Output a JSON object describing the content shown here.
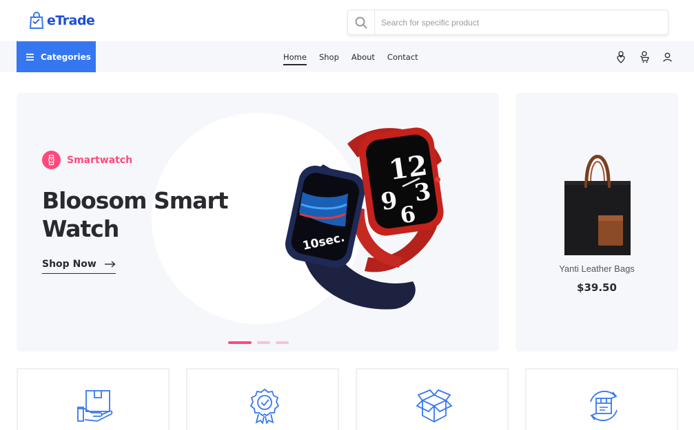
{
  "header": {
    "brand_name": "eTrade",
    "logo_icon": "shopping-bag-icon",
    "search": {
      "placeholder": "Search for specific product",
      "value": "",
      "icon": "search-icon"
    }
  },
  "nav": {
    "categories_label": "Categories",
    "categories_icon": "menu-icon",
    "links": [
      {
        "label": "Home",
        "active": true
      },
      {
        "label": "Shop",
        "active": false
      },
      {
        "label": "About",
        "active": false
      },
      {
        "label": "Contact",
        "active": false
      }
    ],
    "icons": [
      "wishlist-icon",
      "cart-icon",
      "user-icon"
    ]
  },
  "hero": {
    "tag_label": "Smartwatch",
    "tag_icon": "watch-icon",
    "title": "Bloosom Smart Watch",
    "cta_label": "Shop Now",
    "cta_icon": "arrow-right-icon",
    "image": "smartwatch-image",
    "watch_face_left": "10sec.",
    "watch_face_right": "12 9 3 6",
    "slides": 3,
    "active_slide": 1
  },
  "side_product": {
    "name": "Yanti Leather Bags",
    "price": "$39.50",
    "image": "leather-bag-image"
  },
  "features": [
    {
      "icon": "delivery-box-icon"
    },
    {
      "icon": "quality-badge-icon"
    },
    {
      "icon": "open-box-icon"
    },
    {
      "icon": "return-box-icon"
    }
  ],
  "colors": {
    "accent_blue": "#3577f0",
    "accent_pink": "#ff497c",
    "brand_blue": "#1d4ed8",
    "panel_bg": "#f6f7fb",
    "text_dark": "#292930"
  }
}
